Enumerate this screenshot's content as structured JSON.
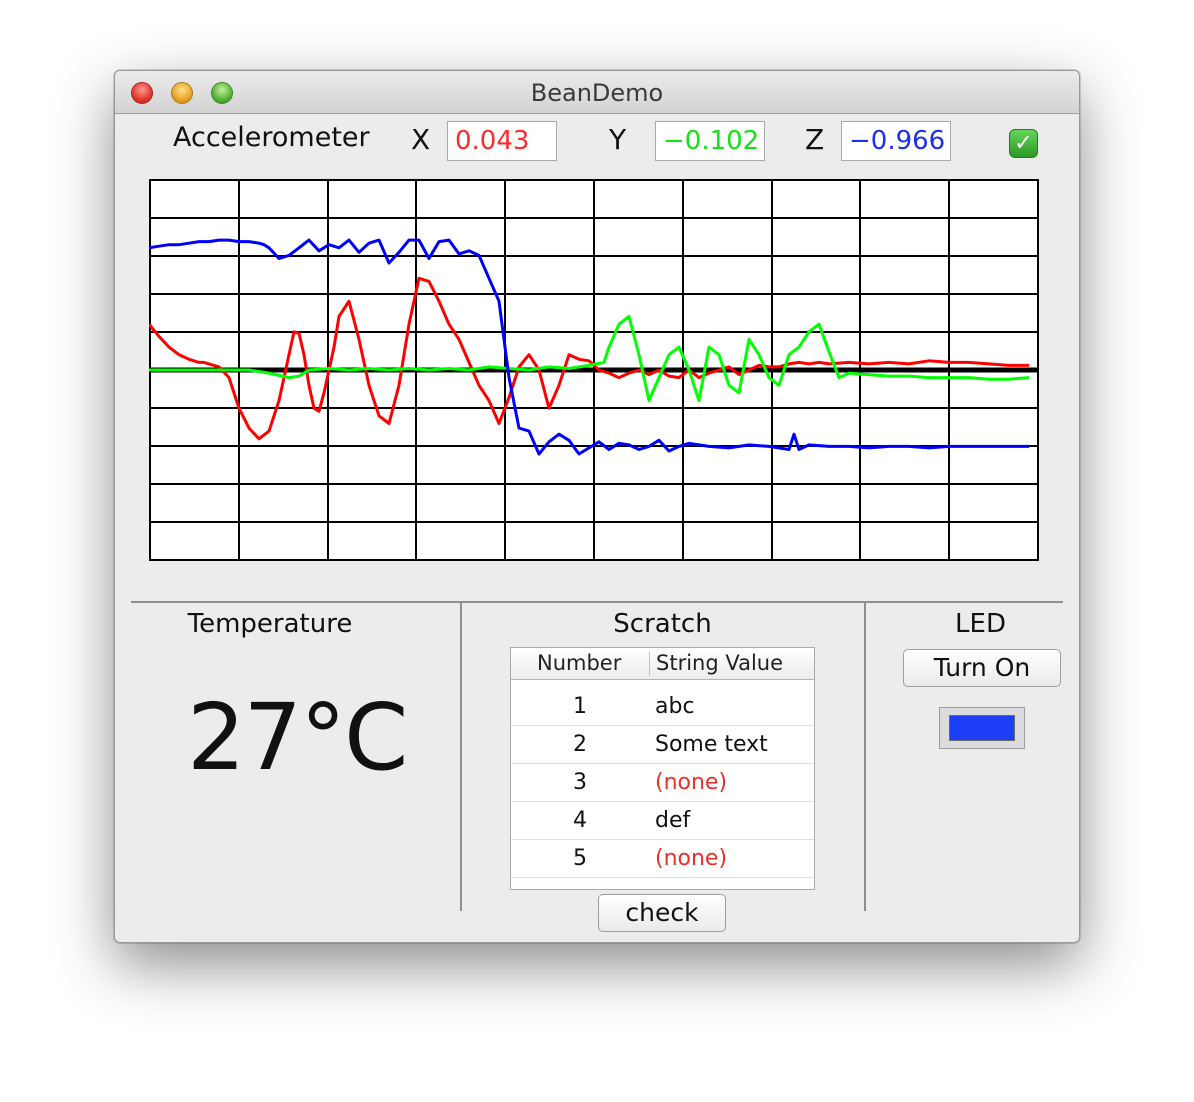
{
  "window": {
    "title": "BeanDemo"
  },
  "accelerometer": {
    "label": "Accelerometer",
    "x_label": "X",
    "x_value": "0.043",
    "x_color": "#ff2a2a",
    "y_label": "Y",
    "y_value": "−0.102",
    "y_color": "#16e01a",
    "z_label": "Z",
    "z_value": "−0.966",
    "z_color": "#1a2ff0",
    "enabled": true
  },
  "chart_data": {
    "type": "line",
    "title": "",
    "xlabel": "",
    "ylabel": "",
    "grid": true,
    "ylim": [
      -1.25,
      1.25
    ],
    "series": [
      {
        "color": "#ff0000",
        "x": [
          0,
          10,
          20,
          30,
          40,
          50,
          55,
          60,
          70,
          80,
          85,
          90,
          100,
          110,
          120,
          130,
          140,
          145,
          150,
          155,
          160,
          165,
          170,
          175,
          180,
          185,
          190,
          200,
          210,
          220,
          230,
          240,
          250,
          260,
          270,
          280,
          290,
          300,
          310,
          320,
          330,
          340,
          350,
          360,
          370,
          380,
          390,
          400,
          410,
          420,
          430,
          440,
          450,
          460,
          470,
          480,
          490,
          500,
          510,
          520,
          530,
          540,
          550,
          560,
          570,
          580,
          590,
          600,
          610,
          620,
          630,
          640,
          650,
          660,
          670,
          680,
          700,
          720,
          740,
          760,
          780,
          800,
          820,
          840,
          860,
          880
        ],
        "y": [
          0.3,
          0.22,
          0.15,
          0.1,
          0.07,
          0.05,
          0.05,
          0.04,
          0.02,
          -0.05,
          -0.15,
          -0.25,
          -0.38,
          -0.45,
          -0.4,
          -0.2,
          0.1,
          0.25,
          0.24,
          0.1,
          -0.1,
          -0.25,
          -0.27,
          -0.15,
          0.0,
          0.15,
          0.35,
          0.45,
          0.2,
          -0.1,
          -0.3,
          -0.35,
          -0.1,
          0.3,
          0.6,
          0.58,
          0.45,
          0.3,
          0.2,
          0.05,
          -0.1,
          -0.2,
          -0.35,
          -0.18,
          0.02,
          0.1,
          0.0,
          -0.25,
          -0.1,
          0.1,
          0.07,
          0.06,
          0.0,
          -0.02,
          -0.05,
          -0.02,
          0.0,
          -0.03,
          0.0,
          -0.04,
          -0.05,
          0.0,
          -0.05,
          -0.02,
          0.0,
          0.02,
          -0.03,
          0.0,
          0.03,
          0.02,
          0.02,
          0.04,
          0.05,
          0.04,
          0.05,
          0.04,
          0.05,
          0.04,
          0.05,
          0.04,
          0.06,
          0.05,
          0.05,
          0.04,
          0.03,
          0.03
        ]
      },
      {
        "color": "#00ff00",
        "x": [
          0,
          20,
          40,
          60,
          80,
          100,
          120,
          140,
          150,
          160,
          180,
          200,
          220,
          240,
          260,
          280,
          300,
          320,
          340,
          360,
          380,
          400,
          420,
          440,
          455,
          460,
          470,
          480,
          490,
          500,
          510,
          520,
          530,
          540,
          550,
          560,
          570,
          580,
          590,
          600,
          610,
          620,
          630,
          640,
          650,
          660,
          670,
          680,
          690,
          700,
          720,
          740,
          760,
          780,
          800,
          820,
          840,
          860,
          880
        ],
        "y": [
          0.0,
          0.0,
          0.0,
          0.0,
          0.0,
          0.0,
          -0.02,
          -0.05,
          -0.04,
          0.0,
          0.01,
          0.0,
          0.01,
          0.0,
          0.01,
          0.0,
          0.01,
          0.0,
          0.02,
          0.01,
          0.0,
          0.02,
          0.01,
          0.03,
          0.05,
          0.15,
          0.3,
          0.35,
          0.1,
          -0.2,
          -0.05,
          0.1,
          0.15,
          0.0,
          -0.2,
          0.15,
          0.1,
          -0.1,
          -0.15,
          0.2,
          0.1,
          -0.05,
          -0.1,
          0.1,
          0.15,
          0.25,
          0.3,
          0.12,
          -0.05,
          -0.02,
          -0.03,
          -0.04,
          -0.04,
          -0.05,
          -0.05,
          -0.05,
          -0.06,
          -0.06,
          -0.05
        ]
      },
      {
        "color": "#0000ff",
        "x": [
          0,
          10,
          20,
          30,
          40,
          50,
          60,
          70,
          80,
          90,
          100,
          110,
          115,
          120,
          130,
          140,
          150,
          160,
          170,
          180,
          190,
          200,
          210,
          220,
          230,
          240,
          250,
          260,
          270,
          280,
          290,
          300,
          310,
          320,
          330,
          340,
          350,
          355,
          360,
          370,
          380,
          390,
          400,
          410,
          420,
          430,
          440,
          450,
          460,
          470,
          480,
          490,
          500,
          510,
          520,
          530,
          540,
          560,
          580,
          600,
          620,
          640,
          645,
          650,
          660,
          680,
          700,
          720,
          740,
          760,
          780,
          800,
          820,
          840,
          860,
          880
        ],
        "y": [
          0.8,
          0.81,
          0.82,
          0.82,
          0.83,
          0.84,
          0.84,
          0.85,
          0.85,
          0.84,
          0.84,
          0.83,
          0.82,
          0.8,
          0.73,
          0.75,
          0.8,
          0.85,
          0.78,
          0.82,
          0.8,
          0.85,
          0.77,
          0.83,
          0.85,
          0.7,
          0.77,
          0.85,
          0.85,
          0.73,
          0.84,
          0.85,
          0.76,
          0.78,
          0.75,
          0.6,
          0.45,
          0.2,
          -0.05,
          -0.38,
          -0.4,
          -0.55,
          -0.47,
          -0.42,
          -0.46,
          -0.55,
          -0.51,
          -0.47,
          -0.52,
          -0.48,
          -0.49,
          -0.52,
          -0.5,
          -0.46,
          -0.53,
          -0.5,
          -0.48,
          -0.5,
          -0.51,
          -0.49,
          -0.5,
          -0.52,
          -0.42,
          -0.52,
          -0.49,
          -0.5,
          -0.5,
          -0.51,
          -0.5,
          -0.5,
          -0.51,
          -0.5,
          -0.5,
          -0.5,
          -0.5,
          -0.5
        ]
      }
    ]
  },
  "temperature": {
    "label": "Temperature",
    "value": "27°C"
  },
  "scratch": {
    "label": "Scratch",
    "columns": [
      "Number",
      "String Value"
    ],
    "rows": [
      {
        "number": "1",
        "value": "abc",
        "color": "#111111"
      },
      {
        "number": "2",
        "value": "Some text",
        "color": "#111111"
      },
      {
        "number": "3",
        "value": "(none)",
        "color": "#e8302a"
      },
      {
        "number": "4",
        "value": "def",
        "color": "#111111"
      },
      {
        "number": "5",
        "value": "(none)",
        "color": "#e8302a"
      }
    ],
    "check_label": "check"
  },
  "led": {
    "label": "LED",
    "button_label": "Turn On",
    "color": "#1b3ef6"
  }
}
